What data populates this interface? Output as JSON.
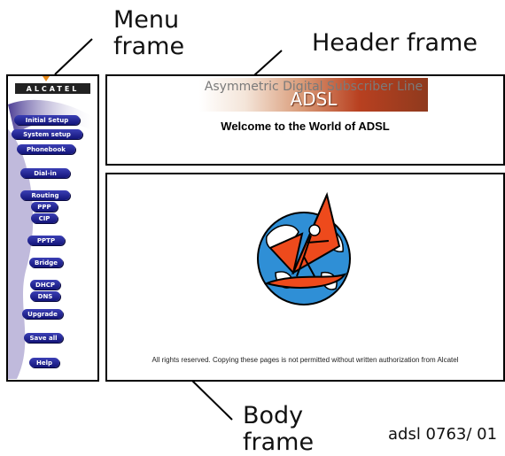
{
  "callouts": {
    "menu_line1": "Menu",
    "menu_line2": "frame",
    "header": "Header frame",
    "body_line1": "Body",
    "body_line2": "frame"
  },
  "doc_ref": "adsl 0763/ 01",
  "menu": {
    "logo": "ALCATEL",
    "items": [
      {
        "label": "Initial Setup"
      },
      {
        "label": "System setup"
      },
      {
        "label": "Phonebook"
      },
      {
        "label": "Dial-in"
      },
      {
        "label": "Routing"
      },
      {
        "label": "PPP"
      },
      {
        "label": "CIP"
      },
      {
        "label": "PPTP"
      },
      {
        "label": "Bridge"
      },
      {
        "label": "DHCP"
      },
      {
        "label": "DNS"
      },
      {
        "label": "Upgrade"
      },
      {
        "label": "Save all"
      },
      {
        "label": "Help"
      }
    ]
  },
  "header": {
    "banner_subtitle": "Asymmetric Digital Subscriber Line",
    "banner_title": "ADSL",
    "welcome": "Welcome to the World of ADSL"
  },
  "body": {
    "rights": "All rights reserved. Copying these pages is not permitted without written authorization from Alcatel"
  },
  "colors": {
    "button": "#1c1f8f",
    "banner_accent": "#b84020",
    "globe_ocean": "#2f8fd6",
    "sail": "#ee4a1c"
  }
}
